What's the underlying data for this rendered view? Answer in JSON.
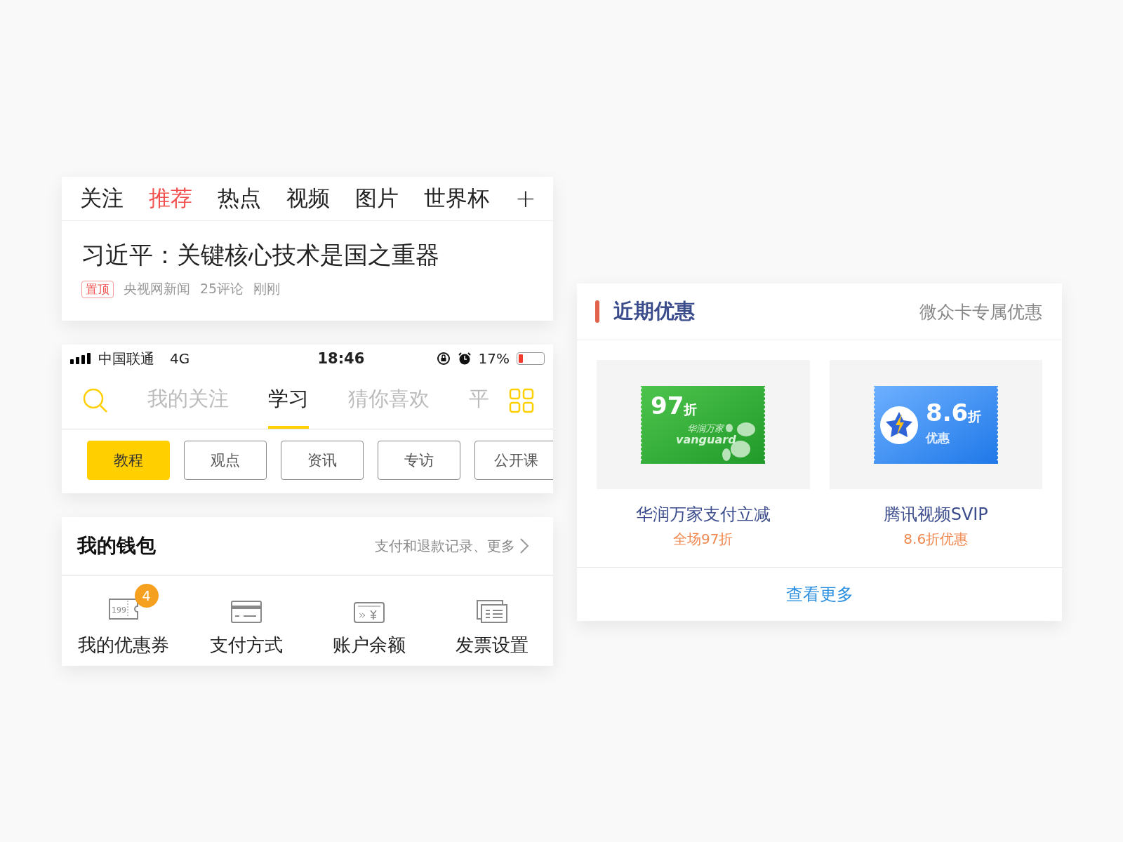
{
  "news_card": {
    "tabs": [
      {
        "label": "关注",
        "selected": false
      },
      {
        "label": "推荐",
        "selected": true
      },
      {
        "label": "热点",
        "selected": false
      },
      {
        "label": "视频",
        "selected": false
      },
      {
        "label": "图片",
        "selected": false
      },
      {
        "label": "世界杯",
        "selected": false
      }
    ],
    "add_button": "+",
    "article": {
      "headline": "习近平：关键核心技术是国之重器",
      "tag": "置顶",
      "source": "央视网新闻",
      "comments": "25评论",
      "time": "刚刚"
    }
  },
  "learn_card": {
    "status_bar": {
      "carrier": "中国联通",
      "network": "4G",
      "time": "18:46",
      "battery": "17%",
      "level": 0.17
    },
    "tabs": [
      {
        "label": "我的关注",
        "selected": false
      },
      {
        "label": "学习",
        "selected": true
      },
      {
        "label": "猜你喜欢",
        "selected": false
      },
      {
        "label": "平",
        "selected": false
      }
    ],
    "chips": [
      {
        "label": "教程",
        "selected": true
      },
      {
        "label": "观点",
        "selected": false
      },
      {
        "label": "资讯",
        "selected": false
      },
      {
        "label": "专访",
        "selected": false
      },
      {
        "label": "公开课",
        "selected": false
      }
    ]
  },
  "wallet_card": {
    "title": "我的钱包",
    "link": "支付和退款记录、更多",
    "items": [
      {
        "kind": "coupon",
        "label": "我的优惠券",
        "icon_text": "199",
        "badge": "4"
      },
      {
        "kind": "card",
        "label": "支付方式"
      },
      {
        "kind": "balance",
        "label": "账户余额"
      },
      {
        "kind": "invoice",
        "label": "发票设置"
      }
    ]
  },
  "offers_card": {
    "title": "近期优惠",
    "subtitle": "微众卡专属优惠",
    "offers": [
      {
        "kind": "grocery",
        "amount": "97",
        "unit": "折",
        "brand": "华润万家",
        "brand_latin": "vanguard",
        "title": "华润万家支付立减",
        "detail": "全场97折"
      },
      {
        "kind": "video",
        "amount": "8.6",
        "unit": "折",
        "caption": "优惠",
        "title": "腾讯视频SVIP",
        "detail": "8.6折优惠"
      }
    ],
    "more": "查看更多"
  }
}
